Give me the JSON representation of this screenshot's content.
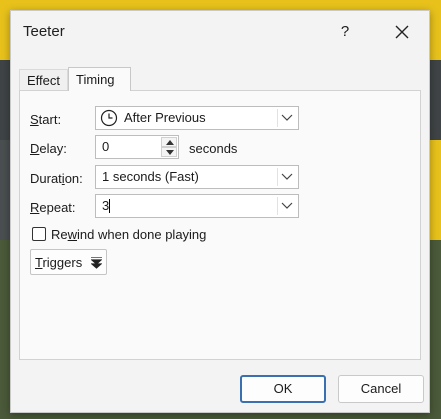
{
  "dialog": {
    "title": "Teeter",
    "help_label": "?",
    "close_label": "✕"
  },
  "tabs": [
    {
      "label": "Effect",
      "active": false
    },
    {
      "label": "Timing",
      "active": true
    }
  ],
  "timing": {
    "start": {
      "label_pre": "",
      "label_u": "S",
      "label_post": "tart:",
      "value": "After Previous"
    },
    "delay": {
      "label_pre": "",
      "label_u": "D",
      "label_post": "elay:",
      "value": "0",
      "unit": "seconds"
    },
    "duration": {
      "label_pre": "Durat",
      "label_u": "i",
      "label_post": "on:",
      "value": "1 seconds (Fast)"
    },
    "repeat": {
      "label_pre": "",
      "label_u": "R",
      "label_post": "epeat:",
      "value": "3"
    },
    "rewind": {
      "label_pre": "Re",
      "label_u": "w",
      "label_post": "ind when done playing",
      "checked": false
    },
    "triggers": {
      "label_pre": "",
      "label_u": "T",
      "label_post": "riggers"
    }
  },
  "footer": {
    "ok_label": "OK",
    "cancel_label": "Cancel"
  },
  "colors": {
    "accent": "#3a6fb0",
    "background_slide_yellow": "#e8c21b"
  }
}
